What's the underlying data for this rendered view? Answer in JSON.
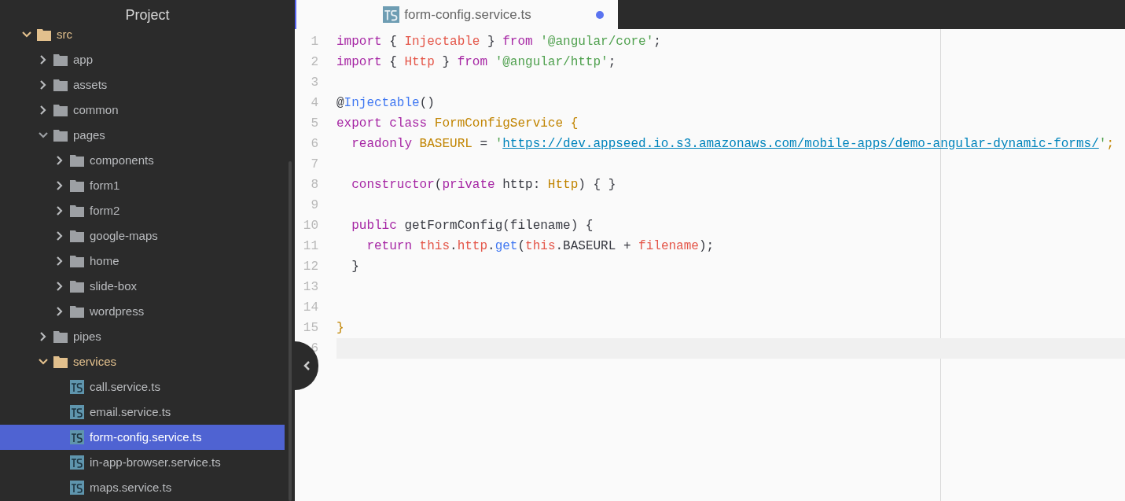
{
  "sidebar": {
    "title": "Project",
    "tree": [
      {
        "name": "src",
        "kind": "folder",
        "expanded": true,
        "selected": false,
        "color": "#e2c08d",
        "children": [
          {
            "name": "app",
            "kind": "folder",
            "expanded": false,
            "selected": false,
            "color": "#9da0a4"
          },
          {
            "name": "assets",
            "kind": "folder",
            "expanded": false,
            "selected": false,
            "color": "#9da0a4"
          },
          {
            "name": "common",
            "kind": "folder",
            "expanded": false,
            "selected": false,
            "color": "#9da0a4"
          },
          {
            "name": "pages",
            "kind": "folder",
            "expanded": true,
            "selected": false,
            "color": "#9da0a4",
            "children": [
              {
                "name": "components",
                "kind": "folder",
                "expanded": false,
                "selected": false,
                "color": "#9da0a4"
              },
              {
                "name": "form1",
                "kind": "folder",
                "expanded": false,
                "selected": false,
                "color": "#9da0a4"
              },
              {
                "name": "form2",
                "kind": "folder",
                "expanded": false,
                "selected": false,
                "color": "#9da0a4"
              },
              {
                "name": "google-maps",
                "kind": "folder",
                "expanded": false,
                "selected": false,
                "color": "#9da0a4"
              },
              {
                "name": "home",
                "kind": "folder",
                "expanded": false,
                "selected": false,
                "color": "#9da0a4"
              },
              {
                "name": "slide-box",
                "kind": "folder",
                "expanded": false,
                "selected": false,
                "color": "#9da0a4"
              },
              {
                "name": "wordpress",
                "kind": "folder",
                "expanded": false,
                "selected": false,
                "color": "#9da0a4"
              }
            ]
          },
          {
            "name": "pipes",
            "kind": "folder",
            "expanded": false,
            "selected": false,
            "color": "#9da0a4"
          },
          {
            "name": "services",
            "kind": "folder",
            "expanded": true,
            "selected": false,
            "color": "#e2c08d",
            "children": [
              {
                "name": "call.service.ts",
                "kind": "file",
                "selected": false
              },
              {
                "name": "email.service.ts",
                "kind": "file",
                "selected": false
              },
              {
                "name": "form-config.service.ts",
                "kind": "file",
                "selected": true
              },
              {
                "name": "in-app-browser.service.ts",
                "kind": "file",
                "selected": false
              },
              {
                "name": "maps.service.ts",
                "kind": "file",
                "selected": false
              }
            ]
          }
        ]
      }
    ]
  },
  "tabs": [
    {
      "label": "form-config.service.ts",
      "selected": true,
      "modified": true
    }
  ],
  "editor": {
    "lines": [
      {
        "number": "1",
        "current": false,
        "tokens": [
          {
            "text": "import",
            "kind": "keyword"
          },
          {
            "text": " {",
            "kind": "plain"
          },
          {
            "text": " Injectable",
            "kind": "variable"
          },
          {
            "text": " }",
            "kind": "plain"
          },
          {
            "text": " from",
            "kind": "keyword"
          },
          {
            "text": " '@angular/core'",
            "kind": "string"
          },
          {
            "text": ";",
            "kind": "plain"
          }
        ]
      },
      {
        "number": "2",
        "current": false,
        "tokens": [
          {
            "text": "import",
            "kind": "keyword"
          },
          {
            "text": " {",
            "kind": "plain"
          },
          {
            "text": " Http",
            "kind": "variable"
          },
          {
            "text": " }",
            "kind": "plain"
          },
          {
            "text": " from",
            "kind": "keyword"
          },
          {
            "text": " '@angular/http'",
            "kind": "string"
          },
          {
            "text": ";",
            "kind": "plain"
          }
        ]
      },
      {
        "number": "3",
        "current": false
      },
      {
        "number": "4",
        "current": false,
        "tokens": [
          {
            "text": "@",
            "kind": "plain"
          },
          {
            "text": "Injectable",
            "kind": "function"
          },
          {
            "text": "()",
            "kind": "plain"
          }
        ]
      },
      {
        "number": "5",
        "current": false,
        "tokens": [
          {
            "text": "export",
            "kind": "keyword"
          },
          {
            "text": " class",
            "kind": "keyword"
          },
          {
            "text": " FormConfigService {",
            "kind": "type"
          }
        ]
      },
      {
        "number": "6",
        "current": false,
        "tokens": [
          {
            "text": "  readonly",
            "kind": "keyword"
          },
          {
            "text": " BASEURL",
            "kind": "type"
          },
          {
            "text": " =",
            "kind": "plain"
          },
          {
            "text": " '",
            "kind": "string"
          },
          {
            "text": "https://dev.appseed.io.s3.amazonaws.com/mobile-apps/demo-angular-dynamic-forms/",
            "kind": "link"
          },
          {
            "text": "'",
            "kind": "string"
          },
          {
            "text": ";",
            "kind": "type"
          }
        ]
      },
      {
        "number": "7",
        "current": false
      },
      {
        "number": "8",
        "current": false,
        "tokens": [
          {
            "text": "  constructor",
            "kind": "keyword"
          },
          {
            "text": "(",
            "kind": "plain"
          },
          {
            "text": "private",
            "kind": "keyword"
          },
          {
            "text": " http:",
            "kind": "plain"
          },
          {
            "text": " Http",
            "kind": "type"
          },
          {
            "text": ") { }",
            "kind": "plain"
          }
        ]
      },
      {
        "number": "9",
        "current": false
      },
      {
        "number": "10",
        "current": false,
        "tokens": [
          {
            "text": "  public",
            "kind": "keyword"
          },
          {
            "text": " getFormConfig(filename) {",
            "kind": "plain"
          }
        ]
      },
      {
        "number": "11",
        "current": false,
        "tokens": [
          {
            "text": "    return",
            "kind": "keyword"
          },
          {
            "text": " this",
            "kind": "variable"
          },
          {
            "text": ".",
            "kind": "plain"
          },
          {
            "text": "http",
            "kind": "variable"
          },
          {
            "text": ".",
            "kind": "plain"
          },
          {
            "text": "get",
            "kind": "function"
          },
          {
            "text": "(",
            "kind": "plain"
          },
          {
            "text": "this",
            "kind": "variable"
          },
          {
            "text": ".BASEURL +",
            "kind": "plain"
          },
          {
            "text": " filename",
            "kind": "variable"
          },
          {
            "text": ");",
            "kind": "plain"
          }
        ]
      },
      {
        "number": "12",
        "current": false,
        "tokens": [
          {
            "text": "  }",
            "kind": "plain"
          }
        ]
      },
      {
        "number": "13",
        "current": false
      },
      {
        "number": "14",
        "current": false
      },
      {
        "number": "15",
        "current": false,
        "tokens": [
          {
            "text": "}",
            "kind": "type"
          }
        ]
      },
      {
        "number": "6",
        "current": true
      }
    ]
  }
}
